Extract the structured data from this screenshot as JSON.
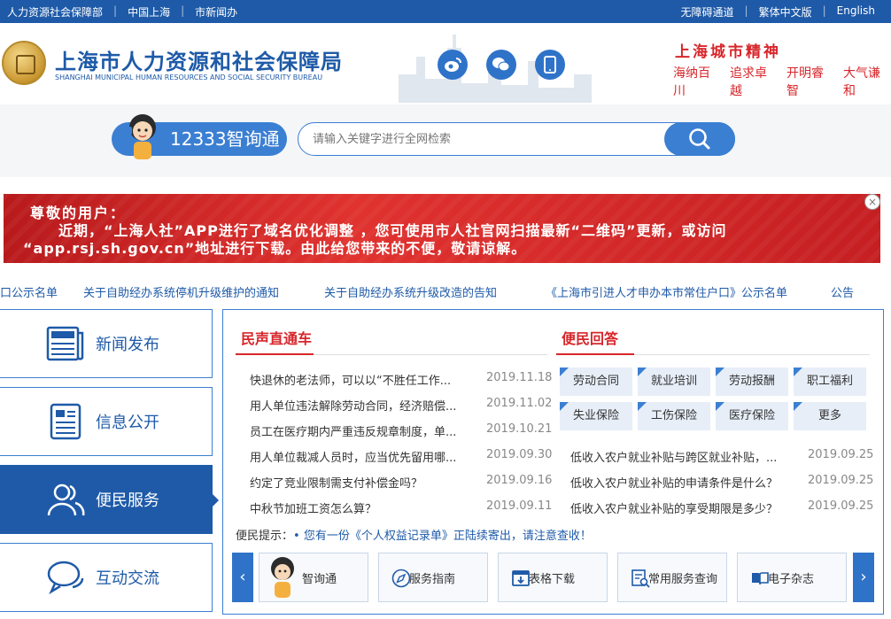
{
  "topbar": {
    "left_links": [
      "人力资源社会保障部",
      "中国上海",
      "市新闻办"
    ],
    "right_links": [
      "无障碍通道",
      "繁体中文版",
      "English"
    ]
  },
  "header": {
    "title_cn": "上海市人力资源和社会保障局",
    "title_en": "SHANGHAI MUNICIPAL HUMAN RESOURCES AND SOCIAL SECURITY BUREAU",
    "social_icons": [
      "weibo-icon",
      "wechat-icon",
      "mobile-icon"
    ],
    "spirit_title": "上海城市精神",
    "spirit_words": [
      "海纳百川",
      "追求卓越",
      "开明睿智",
      "大气谦和"
    ]
  },
  "search": {
    "zxt_label": "12333智询通",
    "placeholder": "请输入关键字进行全网检索"
  },
  "banner": {
    "line1": "尊敬的用户：",
    "line2": "近期，“上海人社”APP进行了域名优化调整 ，您可使用市人社官网扫描最新“二维码”更新，或访问",
    "line3": "“app.rsj.sh.gov.cn”地址进行下载。由此给您带来的不便，敬请谅解。",
    "close": "×"
  },
  "ticker": [
    "口公示名单",
    "关于自助经办系统停机升级维护的通知",
    "关于自助经办系统升级改造的告知",
    "《上海市引进人才申办本市常住户口》公示名单",
    "公告"
  ],
  "sidenav": [
    {
      "label": "新闻发布",
      "icon": "newspaper-icon"
    },
    {
      "label": "信息公开",
      "icon": "document-icon"
    },
    {
      "label": "便民服务",
      "icon": "users-icon"
    },
    {
      "label": "互动交流",
      "icon": "chat-icon"
    }
  ],
  "minsheng": {
    "title": "民声直通车",
    "items": [
      {
        "title": "快退休的老法师，可以以“不胜任工作...",
        "date": "2019.11.18"
      },
      {
        "title": "用人单位违法解除劳动合同，经济赔偿...",
        "date": "2019.11.02"
      },
      {
        "title": "员工在医疗期内严重违反规章制度，单...",
        "date": "2019.10.21"
      },
      {
        "title": "用人单位裁减人员时，应当优先留用哪...",
        "date": "2019.09.30"
      },
      {
        "title": "约定了竞业限制需支付补偿金吗？",
        "date": "2019.09.16"
      },
      {
        "title": "中秋节加班工资怎么算？",
        "date": "2019.09.11"
      }
    ]
  },
  "bianmin": {
    "title": "便民回答",
    "tags": [
      "劳动合同",
      "就业培训",
      "劳动报酬",
      "职工福利",
      "失业保险",
      "工伤保险",
      "医疗保险",
      "更多"
    ],
    "items": [
      {
        "title": "低收入农户就业补贴与跨区就业补贴，...",
        "date": "2019.09.25"
      },
      {
        "title": "低收入农户就业补贴的申请条件是什么？",
        "date": "2019.09.25"
      },
      {
        "title": "低收入农户就业补贴的享受期限是多少？",
        "date": "2019.09.25"
      }
    ]
  },
  "tip": {
    "label": "便民提示：",
    "message": "• 您有一份《个人权益记录单》正陆续寄出，请注意查收！"
  },
  "services": [
    {
      "label": "智询通",
      "icon": "assistant-avatar-icon"
    },
    {
      "label": "服务指南",
      "icon": "compass-icon"
    },
    {
      "label": "表格下载",
      "icon": "download-form-icon"
    },
    {
      "label": "常用服务查询",
      "icon": "search-document-icon"
    },
    {
      "label": "电子杂志",
      "icon": "book-icon"
    }
  ],
  "colors": {
    "primary": "#1e5aa8",
    "accent": "#d7262b",
    "banner_red": "#c51f22"
  }
}
